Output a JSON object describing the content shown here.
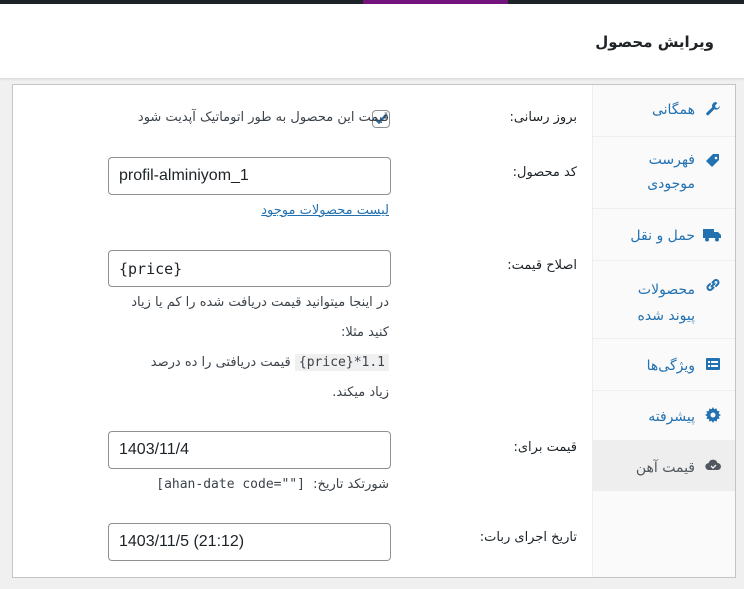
{
  "header": {
    "title": "ویرایش محصول"
  },
  "tabs": [
    {
      "label": "همگانی",
      "icon": "wrench-icon"
    },
    {
      "label": "فهرست موجودی",
      "icon": "tag-icon"
    },
    {
      "label": "حمل و نقل",
      "icon": "truck-icon"
    },
    {
      "label": "محصولات پیوند شده",
      "icon": "link-icon"
    },
    {
      "label": "ویژگی‌ها",
      "icon": "list-icon"
    },
    {
      "label": "پیشرفته",
      "icon": "gear-icon"
    },
    {
      "label": "قیمت آهن",
      "icon": "cloud-icon"
    }
  ],
  "fields": {
    "auto_update": {
      "label": "بروز رسانی:",
      "checkbox_text": "قیمت این محصول به طور اتوماتیک آپدیت شود",
      "checked": true
    },
    "product_code": {
      "label": "کد محصول:",
      "value": "profil-alminiyom_1",
      "link": "لیست محصولات موجود"
    },
    "price_fix": {
      "label": "اصلاح قیمت:",
      "value": "{price}",
      "help_line1": "در اینجا میتوانید قیمت دریافت شده را کم یا زیاد",
      "help_line2": "کنید مثلا:",
      "example_code": "{price}*1.1",
      "example_text_a": "قیمت دریافتی را ده درصد",
      "example_text_b": "زیاد میکند."
    },
    "price_for": {
      "label": "قیمت برای:",
      "value": "1403/11/4",
      "shortcode_label": "شورتکد تاریخ:",
      "shortcode": "[ahan-date code=\"\"]"
    },
    "robot_run": {
      "label": "تاریخ اجرای ربات:",
      "value": "1403/11/5 (21:12)"
    }
  },
  "colors": {
    "accent": "#2271b1",
    "admin_bar": "#1d2327",
    "admin_bar_highlight": "#72137c"
  }
}
